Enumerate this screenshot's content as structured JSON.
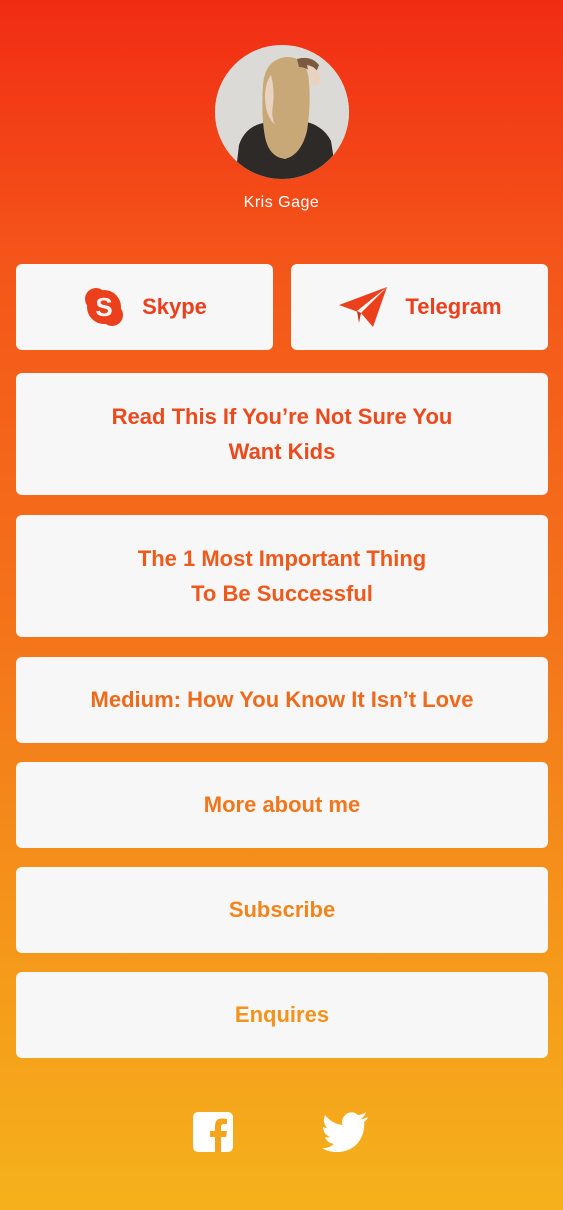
{
  "profile": {
    "name": "Kris Gage",
    "avatar_icon": "profile-photo"
  },
  "contact_buttons": [
    {
      "label": "Skype",
      "icon": "skype-icon"
    },
    {
      "label": "Telegram",
      "icon": "telegram-icon"
    }
  ],
  "links": [
    {
      "lines": [
        "Read This If You’re Not Sure You",
        "Want Kids"
      ]
    },
    {
      "lines": [
        "The 1 Most Important Thing",
        "To Be Successful"
      ]
    },
    {
      "lines": [
        "Medium: How You Know It Isn’t Love"
      ]
    },
    {
      "lines": [
        "More about me"
      ]
    },
    {
      "lines": [
        "Subscribe"
      ]
    },
    {
      "lines": [
        "Enquires"
      ]
    }
  ],
  "social": [
    {
      "icon": "facebook-icon"
    },
    {
      "icon": "twitter-icon"
    }
  ],
  "colors": {
    "gradient_top": "#f12c14",
    "gradient_bottom": "#f5b11c",
    "button_bg": "#f7f7f7",
    "text_accent": "#ec4a1c"
  }
}
